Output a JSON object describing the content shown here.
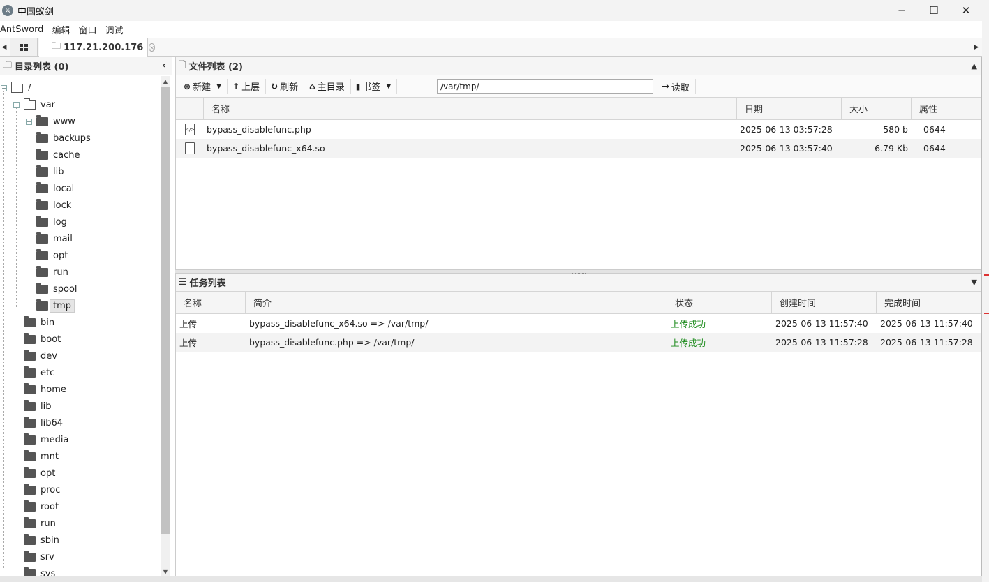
{
  "window": {
    "title": "中国蚁剑",
    "minimize": "─",
    "maximize": "☐",
    "close": "✕"
  },
  "menu": [
    "AntSword",
    "编辑",
    "窗口",
    "调试"
  ],
  "tabs": {
    "home_icon": "grid-icon",
    "active_label": "117.21.200.176",
    "close_glyph": "×"
  },
  "dir_panel": {
    "title": "目录列表 (0)",
    "root": "/",
    "var": "var",
    "var_children": [
      "www",
      "backups",
      "cache",
      "lib",
      "local",
      "lock",
      "log",
      "mail",
      "opt",
      "run",
      "spool",
      "tmp"
    ],
    "root_children": [
      "bin",
      "boot",
      "dev",
      "etc",
      "home",
      "lib",
      "lib64",
      "media",
      "mnt",
      "opt",
      "proc",
      "root",
      "run",
      "sbin",
      "srv",
      "sys"
    ],
    "selected": "tmp"
  },
  "file_panel": {
    "title": "文件列表 (2)",
    "toolbar": {
      "new": "新建",
      "up": "上层",
      "refresh": "刷新",
      "home": "主目录",
      "bookmark": "书签",
      "path": "/var/tmp/",
      "read": "读取"
    },
    "columns": [
      "名称",
      "日期",
      "大小",
      "属性"
    ],
    "rows": [
      {
        "name": "bypass_disablefunc.php",
        "date": "2025-06-13 03:57:28",
        "size": "580 b",
        "attr": "0644",
        "icon": "php-file-icon"
      },
      {
        "name": "bypass_disablefunc_x64.so",
        "date": "2025-06-13 03:57:40",
        "size": "6.79 Kb",
        "attr": "0644",
        "icon": "file-icon"
      }
    ]
  },
  "task_panel": {
    "title": "任务列表",
    "columns": [
      "名称",
      "简介",
      "状态",
      "创建时间",
      "完成时间"
    ],
    "rows": [
      {
        "name": "上传",
        "desc": "bypass_disablefunc_x64.so => /var/tmp/",
        "status": "上传成功",
        "created": "2025-06-13 11:57:40",
        "finished": "2025-06-13 11:57:40"
      },
      {
        "name": "上传",
        "desc": "bypass_disablefunc.php => /var/tmp/",
        "status": "上传成功",
        "created": "2025-06-13 11:57:28",
        "finished": "2025-06-13 11:57:28"
      }
    ],
    "status_color": "#1a8a1a"
  }
}
